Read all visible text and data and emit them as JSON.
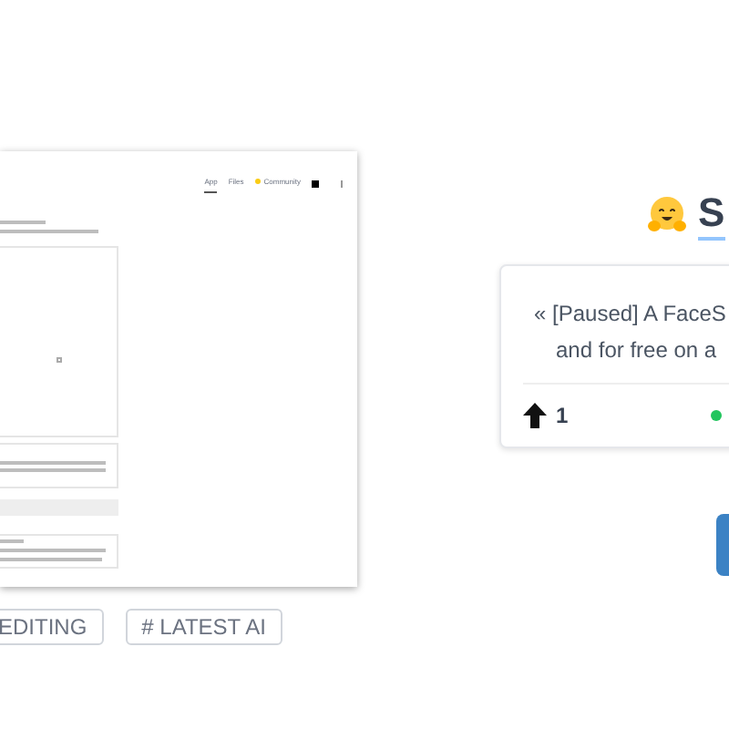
{
  "preview": {
    "tabs": [
      {
        "label": "App",
        "selected": true
      },
      {
        "label": "Files",
        "selected": false
      },
      {
        "label": "Community",
        "selected": false
      }
    ]
  },
  "tags": [
    {
      "label": "EDITING"
    },
    {
      "label": "# LATEST AI"
    }
  ],
  "heading": {
    "label": "S"
  },
  "quote_card": {
    "lines": [
      "« [Paused] A FaceS",
      "and for free on a"
    ],
    "votes": "1"
  }
}
